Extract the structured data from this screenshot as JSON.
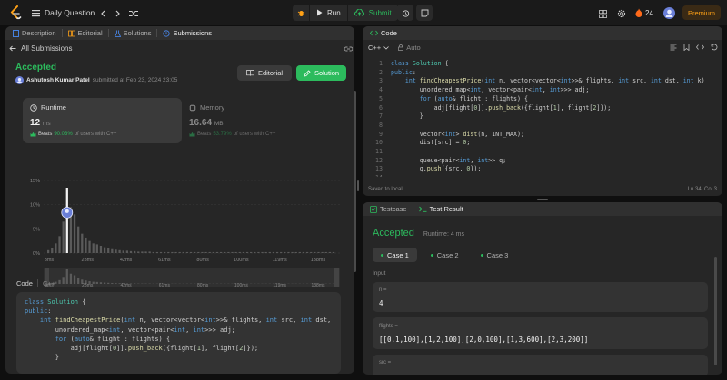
{
  "topbar": {
    "problem_list_label": "Daily Question",
    "run_label": "Run",
    "submit_label": "Submit",
    "streak_count": "24",
    "premium_label": "Premium"
  },
  "left_tabs": {
    "description": "Description",
    "editorial": "Editorial",
    "solutions": "Solutions",
    "submissions": "Submissions"
  },
  "submission": {
    "back_label": "All Submissions",
    "status": "Accepted",
    "author": "Ashutosh Kumar Patel",
    "submitted_text": "submitted at Feb 23, 2024 23:05",
    "editorial_button": "Editorial",
    "solution_button": "Solution"
  },
  "runtime": {
    "label": "Runtime",
    "value": "12",
    "unit": "ms",
    "beats_prefix": "Beats",
    "beats_pct": "90.03%",
    "beats_suffix": "of users with C++"
  },
  "memory": {
    "label": "Memory",
    "value": "16.64",
    "unit": "MB",
    "beats_prefix": "Beats",
    "beats_pct": "53.79%",
    "beats_suffix": "of users with C++"
  },
  "chart_data": {
    "type": "bar",
    "ylabel_ticks": [
      "15%",
      "10%",
      "5%",
      "0%"
    ],
    "ylim": [
      0,
      15
    ],
    "xtick_labels": [
      "3ms",
      "23ms",
      "42ms",
      "61ms",
      "80ms",
      "100ms",
      "119ms",
      "138ms"
    ],
    "series": [
      {
        "values": [
          0.6,
          1.0,
          2.0,
          3.5,
          6.5,
          13.5,
          9.5,
          8.0,
          5.5,
          4.0,
          3.2,
          2.5,
          2.0,
          1.8,
          1.5,
          1.2,
          1.0,
          0.8,
          0.7,
          0.6,
          0.5,
          0.5,
          0.4,
          0.4,
          0.3,
          0.3,
          0.3,
          0.3,
          0.2,
          0.2,
          0.2,
          0.2,
          0.2,
          0.2,
          0.2,
          0.2,
          0.2,
          0.2,
          0.2,
          0.2,
          0.2,
          0.2,
          0.2,
          0.2,
          0.2,
          0.2,
          0.2,
          0.2,
          0.2,
          0.2,
          0.2,
          0.2,
          0.2,
          0.2,
          0.2,
          0.2,
          0.2,
          0.2,
          0.2,
          0.2,
          0.2,
          0.2,
          0.2,
          0.2,
          0.2,
          0.2,
          0.2,
          0.2,
          0.2,
          0.2,
          0.2,
          0.2,
          0.2,
          0.2,
          0.2,
          0.2,
          0.2
        ]
      }
    ],
    "highlight_index": 5,
    "grid": true
  },
  "code_section": {
    "label": "Code",
    "lang": "C++"
  },
  "editor": {
    "title": "Code",
    "language": "C++",
    "mode": "Auto",
    "saved": "Saved to local",
    "cursor": "Ln 34, Col 3"
  },
  "testcase": {
    "tab_testcase": "Testcase",
    "tab_result": "Test Result",
    "status": "Accepted",
    "runtime": "Runtime: 4 ms",
    "cases": [
      "Case 1",
      "Case 2",
      "Case 3"
    ],
    "input_label": "Input",
    "n_label": "n =",
    "n_value": "4",
    "flights_label": "flights =",
    "flights_value": "[[0,1,100],[1,2,100],[2,0,100],[1,3,600],[2,3,200]]",
    "src_label": "src ="
  },
  "colors": {
    "accent_green": "#2cbb5d",
    "brand_orange": "#ffa116"
  }
}
